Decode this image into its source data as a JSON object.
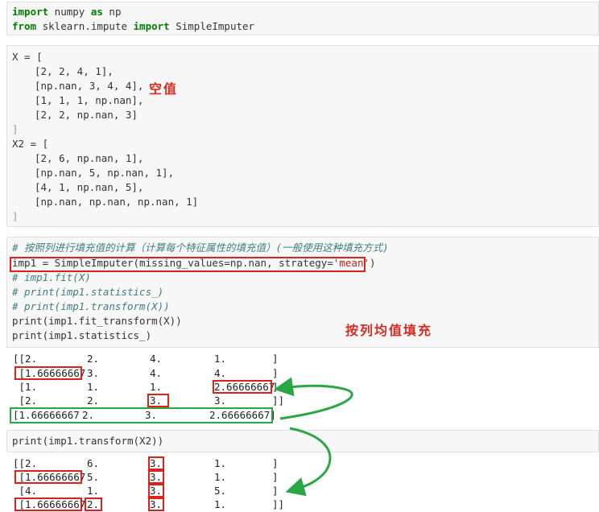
{
  "cell1": {
    "line1": {
      "kw1": "import",
      "mod": " numpy ",
      "kw2": "as",
      "alias": " np"
    },
    "line2": {
      "kw1": "from",
      "mod": " sklearn.impute ",
      "kw2": "import",
      "name": " SimpleImputer"
    }
  },
  "cell2": {
    "x_open": "X = [",
    "x_rows": [
      "[2, 2, 4, 1],",
      "[np.nan, 3, 4, 4],",
      "[1, 1, 1, np.nan],",
      "[2, 2, np.nan, 3]"
    ],
    "x_close": "]",
    "x2_open": "X2 = [",
    "x2_rows": [
      "[2, 6, np.nan, 1],",
      "[np.nan, 5, np.nan, 1],",
      "[4, 1, np.nan, 5],",
      "[np.nan, np.nan, np.nan, 1]"
    ],
    "x2_close": "]",
    "annotation_empty": "空值"
  },
  "cell3": {
    "comment": "# 按照列进行填充值的计算（计算每个特征属性的填充值）(一般使用这种填充方式)",
    "imp_prefix": "imp1 = SimpleImputer(missing_values=np.nan, strategy=",
    "imp_strategy": "'mean'",
    "imp_suffix": ")",
    "c1": "# imp1.fit(X)",
    "c2": "# print(imp1.statistics_)",
    "c3": "# print(imp1.transform(X))",
    "p1": "print(imp1.fit_transform(X))",
    "p2": "print(imp1.statistics_)",
    "annotation_mean": "按列均值填充"
  },
  "output1": {
    "rows": [
      [
        "[[2.",
        "2.",
        "4.",
        "1.",
        "]"
      ],
      [
        " [1.66666667",
        "3.",
        "4.",
        "4.",
        "]"
      ],
      [
        " [1.",
        "1.",
        "1.",
        "2.66666667",
        "]"
      ],
      [
        " [2.",
        "2.",
        "3.",
        "3.",
        "]]"
      ]
    ],
    "statistics": [
      "[1.66666667",
      "2.",
      "3.",
      "2.66666667]"
    ]
  },
  "cell4": {
    "code": "print(imp1.transform(X2))"
  },
  "output2": {
    "rows": [
      [
        "[[2.",
        "6.",
        "3.",
        "1.",
        "]"
      ],
      [
        " [1.66666667",
        "5.",
        "3.",
        "1.",
        "]"
      ],
      [
        " [4.",
        "1.",
        "3.",
        "5.",
        "]"
      ],
      [
        " [1.66666667",
        "2.",
        "3.",
        "1.",
        "]]"
      ]
    ]
  },
  "colors": {
    "annotation_red": "#e0201b",
    "highlight_green": "#2aa745"
  }
}
